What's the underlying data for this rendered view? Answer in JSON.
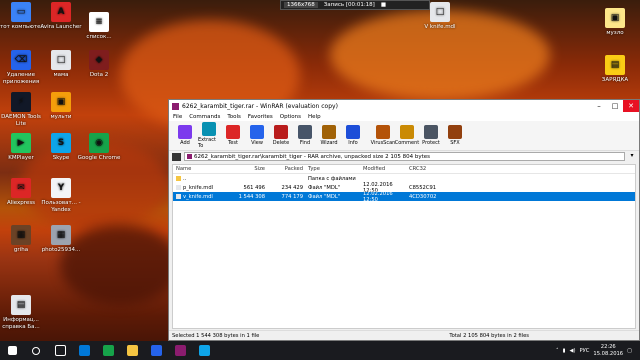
{
  "recorder": {
    "resolution": "1366x768",
    "record_label": "Запись [00:01:18]"
  },
  "desktop_left": [
    {
      "label": "Этот компьюте...",
      "color": "#3b82f6",
      "glyph": "▭"
    },
    {
      "label": "Avira Launcher",
      "color": "#dc2626",
      "glyph": "A"
    },
    {
      "label": "список...",
      "color": "#ffffff",
      "glyph": "≡"
    },
    {
      "label": "Удаление приложения",
      "color": "#2563eb",
      "glyph": "⌫"
    },
    {
      "label": "мама",
      "color": "#e5e7eb",
      "glyph": "□"
    },
    {
      "label": "Dota 2",
      "color": "#7f1d1d",
      "glyph": "◆"
    },
    {
      "label": "DAEMON Tools Lite",
      "color": "#111827",
      "glyph": "⚡"
    },
    {
      "label": "мульти",
      "color": "#f59e0b",
      "glyph": "▣"
    },
    {
      "label": "KMPlayer",
      "color": "#22c55e",
      "glyph": "▶"
    },
    {
      "label": "Skype",
      "color": "#0ea5e9",
      "glyph": "S"
    },
    {
      "label": "Google Chrome",
      "color": "#16a34a",
      "glyph": "◉"
    },
    {
      "label": "Aliexpress",
      "color": "#dc2626",
      "glyph": "✉"
    },
    {
      "label": "Пользоват... - Yandex",
      "color": "#f3f4f6",
      "glyph": "Y"
    },
    {
      "label": "griha",
      "color": "#6b4226",
      "glyph": "▦"
    },
    {
      "label": "photo25934...",
      "color": "#9ca3af",
      "glyph": "▦"
    },
    {
      "label": "Информац... справка Ба...",
      "color": "#e5e7eb",
      "glyph": "▤"
    }
  ],
  "desktop_right": [
    {
      "label": "V knife.mdl",
      "color": "#e5e7eb",
      "glyph": "□"
    },
    {
      "label": "музло",
      "color": "#fde68a",
      "glyph": "▣"
    },
    {
      "label": "ЗАРЯДКА",
      "color": "#facc15",
      "glyph": "▤"
    }
  ],
  "winrar": {
    "title": "6262_karambit_tiger.rar - WinRAR (evaluation copy)",
    "menu": [
      "File",
      "Commands",
      "Tools",
      "Favorites",
      "Options",
      "Help"
    ],
    "tools": [
      {
        "label": "Add",
        "color": "#7c3aed"
      },
      {
        "label": "Extract To",
        "color": "#0891b2"
      },
      {
        "label": "Test",
        "color": "#dc2626"
      },
      {
        "label": "View",
        "color": "#2563eb"
      },
      {
        "label": "Delete",
        "color": "#b91c1c"
      },
      {
        "label": "Find",
        "color": "#475569"
      },
      {
        "label": "Wizard",
        "color": "#a16207"
      },
      {
        "label": "Info",
        "color": "#1d4ed8"
      },
      {
        "label": "VirusScan",
        "color": "#b45309"
      },
      {
        "label": "Comment",
        "color": "#ca8a04"
      },
      {
        "label": "Protect",
        "color": "#4b5563"
      },
      {
        "label": "SFX",
        "color": "#92400e"
      }
    ],
    "path": "6262_karambit_tiger.rar\\karambit_tiger - RAR archive, unpacked size 2 105 804 bytes",
    "columns": {
      "name": "Name",
      "size": "Size",
      "packed": "Packed",
      "type": "Type",
      "modified": "Modified",
      "crc": "CRC32"
    },
    "rows": [
      {
        "name": "..",
        "size": "",
        "packed": "",
        "type": "Папка с файлами",
        "modified": "",
        "crc": "",
        "selected": false,
        "icon": "#f5c542"
      },
      {
        "name": "p_knife.mdl",
        "size": "561 496",
        "packed": "234 429",
        "type": "Файл \"MDL\"",
        "modified": "12.02.2016 12:50",
        "crc": "C8552C91",
        "selected": false,
        "icon": "#e5e7eb"
      },
      {
        "name": "v_knife.mdl",
        "size": "1 544 308",
        "packed": "774 179",
        "type": "Файл \"MDL\"",
        "modified": "12.02.2016 12:50",
        "crc": "4CD30702",
        "selected": true,
        "icon": "#e5e7eb"
      }
    ],
    "status_left": "Selected 1 544 308 bytes in 1 file",
    "status_right": "Total 2 105 804 bytes in 2 files"
  },
  "taskbar": {
    "apps": [
      {
        "name": "start",
        "color": "#ffffff"
      },
      {
        "name": "search",
        "color": "#1a1b1f"
      },
      {
        "name": "task-view",
        "color": "#1a1b1f"
      },
      {
        "name": "edge",
        "color": "#0078d7"
      },
      {
        "name": "chrome",
        "color": "#16a34a"
      },
      {
        "name": "explorer",
        "color": "#f5c542"
      },
      {
        "name": "store",
        "color": "#2563eb"
      },
      {
        "name": "winrar",
        "color": "#8b1c6f"
      },
      {
        "name": "app",
        "color": "#0ea5e9"
      }
    ],
    "lang": "РУС",
    "time": "22:26",
    "date": "15.08.2016"
  }
}
